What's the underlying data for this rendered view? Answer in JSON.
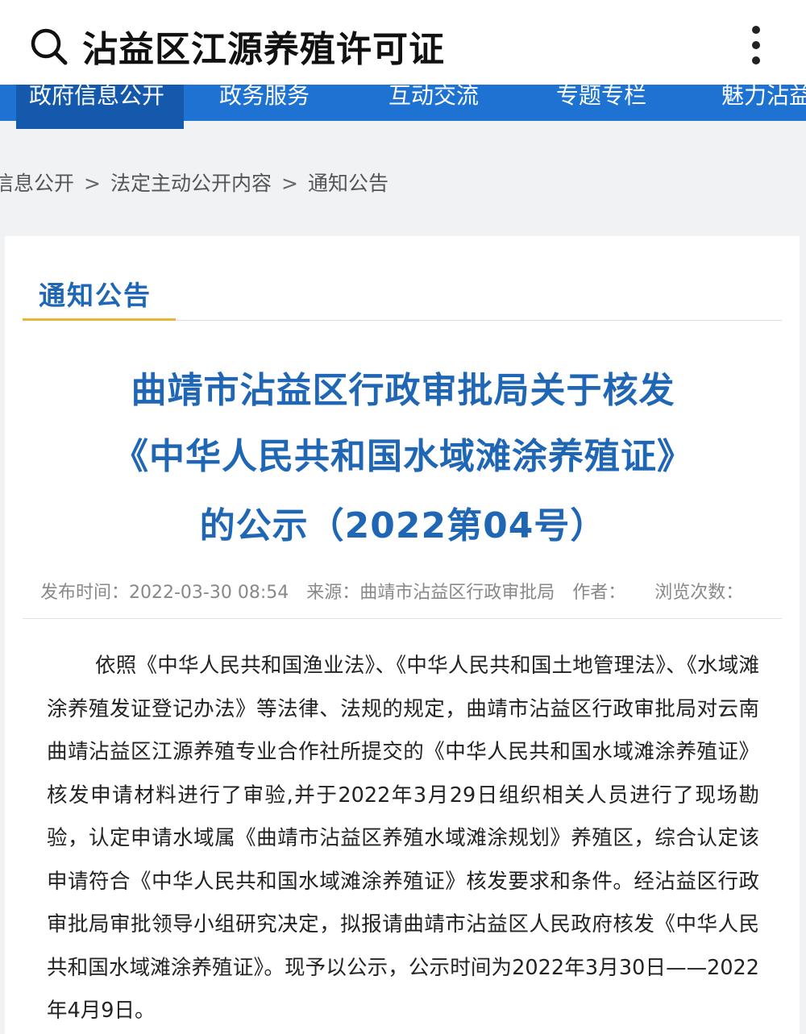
{
  "search": {
    "query": "沾益区江源养殖许可证"
  },
  "nav": {
    "items": [
      "政府信息公开",
      "政务服务",
      "互动交流",
      "专题专栏",
      "魅力沾益"
    ]
  },
  "breadcrumb": [
    "信息公开",
    "法定主动公开内容",
    "通知公告"
  ],
  "breadcrumb_sep": ">",
  "section_title": "通知公告",
  "headline": {
    "line1": "曲靖市沾益区行政审批局关于核发",
    "line2": "《中华人民共和国水域滩涂养殖证》",
    "line3": "的公示（2022第04号）"
  },
  "meta": {
    "publish_time": "发布时间：2022-03-30 08:54",
    "source": "来源：曲靖市沾益区行政审批局",
    "author": "作者：",
    "views": "浏览次数："
  },
  "body": "依照《中华人民共和国渔业法》、《中华人民共和国土地管理法》、《水域滩涂养殖发证登记办法》等法律、法规的规定，曲靖市沾益区行政审批局对云南曲靖沾益区江源养殖专业合作社所提交的《中华人民共和国水域滩涂养殖证》核发申请材料进行了审验,并于2022年3月29日组织相关人员进行了现场勘验，认定申请水域属《曲靖市沾益区养殖水域滩涂规划》养殖区，综合认定该申请符合《中华人民共和国水域滩涂养殖证》核发要求和条件。经沾益区行政审批局审批领导小组研究决定，拟报请曲靖市沾益区人民政府核发《中华人民共和国水域滩涂养殖证》。现予以公示，公示时间为2022年3月30日——2022年4月9日。",
  "colors": {
    "accent": "#1f66b5",
    "nav_bg": "#1e73d2",
    "underline": "#e8b53c"
  }
}
